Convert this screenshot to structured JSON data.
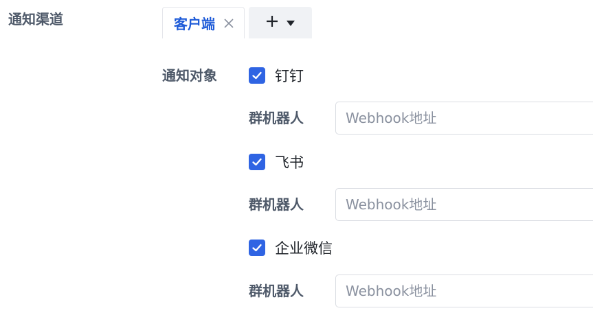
{
  "section": {
    "label": "通知渠道"
  },
  "tabs": {
    "active": {
      "label": "客户端",
      "close_icon": "close-icon"
    },
    "add": {
      "plus_icon": "plus-icon",
      "caret_icon": "caret-down-icon"
    }
  },
  "target": {
    "label": "通知对象",
    "channels": [
      {
        "name": "钉钉",
        "checked": true,
        "robot_label": "群机器人",
        "placeholder": "Webhook地址",
        "value": ""
      },
      {
        "name": "飞书",
        "checked": true,
        "robot_label": "群机器人",
        "placeholder": "Webhook地址",
        "value": ""
      },
      {
        "name": "企业微信",
        "checked": true,
        "robot_label": "群机器人",
        "placeholder": "Webhook地址",
        "value": ""
      }
    ]
  },
  "colors": {
    "accent": "#2f64e3",
    "tab_text": "#1e5bd8",
    "label": "#4e5969"
  }
}
